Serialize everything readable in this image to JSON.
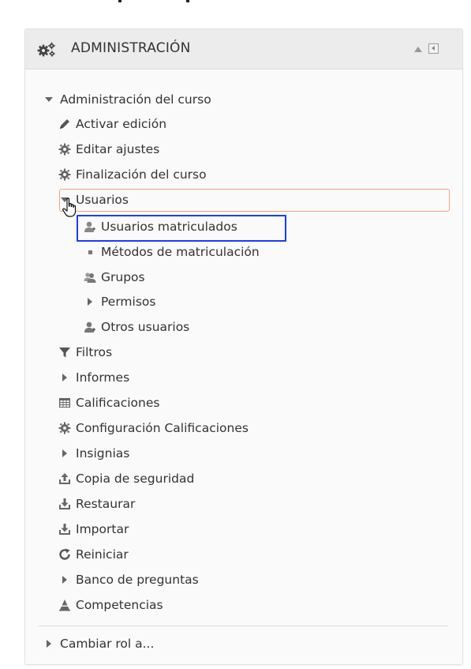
{
  "block": {
    "title": "ADMINISTRACIÓN",
    "icons": {
      "header": "gears-icon",
      "collapse": "collapse-up-icon",
      "dock": "dock-left-icon"
    }
  },
  "tree": {
    "root": {
      "label": "Administración del curso",
      "icon": "caret-down-icon"
    },
    "items": [
      {
        "label": "Activar edición",
        "icon": "pencil-icon"
      },
      {
        "label": "Editar ajustes",
        "icon": "gear-icon"
      },
      {
        "label": "Finalización del curso",
        "icon": "gear-icon"
      },
      {
        "label": "Usuarios",
        "icon": "caret-down-icon",
        "state": "expanded"
      },
      {
        "label": "Usuarios matriculados",
        "icon": "enrolled-user-icon",
        "state": "selected"
      },
      {
        "label": "Métodos de matriculación",
        "icon": "square-bullet-icon"
      },
      {
        "label": "Grupos",
        "icon": "group-icon"
      },
      {
        "label": "Permisos",
        "icon": "caret-right-icon"
      },
      {
        "label": "Otros usuarios",
        "icon": "user-plus-icon"
      },
      {
        "label": "Filtros",
        "icon": "filter-icon"
      },
      {
        "label": "Informes",
        "icon": "caret-right-icon"
      },
      {
        "label": "Calificaciones",
        "icon": "grades-table-icon"
      },
      {
        "label": "Configuración Calificaciones",
        "icon": "gear-icon"
      },
      {
        "label": "Insignias",
        "icon": "caret-right-icon"
      },
      {
        "label": "Copia de seguridad",
        "icon": "backup-upload-icon"
      },
      {
        "label": "Restaurar",
        "icon": "restore-download-icon"
      },
      {
        "label": "Importar",
        "icon": "import-download-icon"
      },
      {
        "label": "Reiniciar",
        "icon": "reset-icon"
      },
      {
        "label": "Banco de preguntas",
        "icon": "caret-right-icon"
      },
      {
        "label": "Competencias",
        "icon": "competencies-icon"
      }
    ],
    "footer": {
      "label": "Cambiar rol a...",
      "icon": "caret-right-icon"
    }
  },
  "colors": {
    "highlight_orange": "#f0a37d",
    "highlight_blue": "#1a3cff",
    "icon_gray": "#666666"
  }
}
